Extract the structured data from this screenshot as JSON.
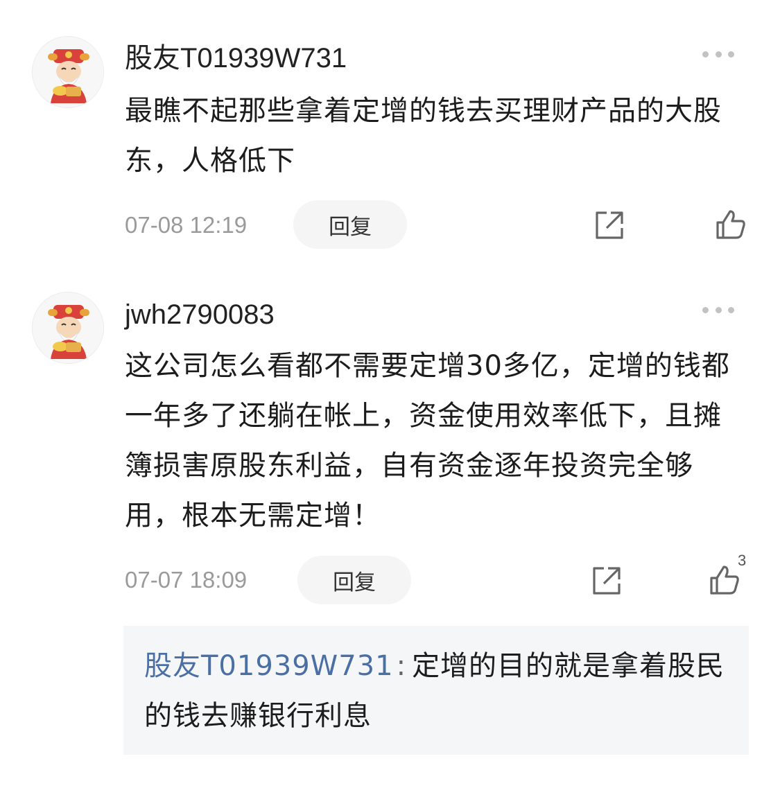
{
  "comments": [
    {
      "username": "股友T01939W731",
      "content": "最瞧不起那些拿着定增的钱去买理财产品的大股东，人格低下",
      "time": "07-08 12:19",
      "reply_label": "回复",
      "like_count": ""
    },
    {
      "username": "jwh2790083",
      "content": "这公司怎么看都不需要定增30多亿，定增的钱都一年多了还躺在帐上，资金使用效率低下，且摊簿损害原股东利益，自有资金逐年投资完全够用，根本无需定增！",
      "time": "07-07 18:09",
      "reply_label": "回复",
      "like_count": "3",
      "sub_reply": {
        "author": "股友T01939W731",
        "separator": ":",
        "text": "定增的目的就是拿着股民的钱去赚银行利息"
      }
    }
  ],
  "icons": {
    "more": "more-dots-icon",
    "share": "share-icon",
    "like": "thumbs-up-icon",
    "avatar": "fortune-god-avatar"
  },
  "colors": {
    "author_link": "#4a6fa5",
    "muted": "#9a9a9a",
    "sub_reply_bg": "#f5f6f8"
  }
}
